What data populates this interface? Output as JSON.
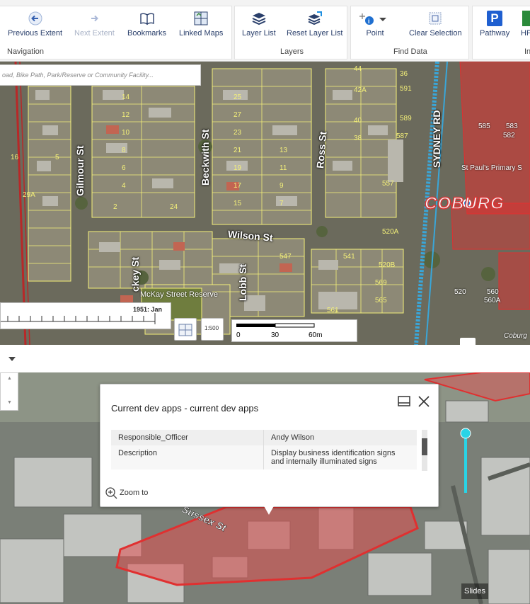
{
  "ribbon": {
    "navigation": {
      "group_label": "Navigation",
      "previous_extent": "Previous Extent",
      "next_extent": "Next Extent",
      "bookmarks": "Bookmarks",
      "linked_maps": "Linked Maps"
    },
    "layers": {
      "group_label": "Layers",
      "layer_list": "Layer List",
      "reset_layer_list": "Reset Layer List"
    },
    "find_data": {
      "group_label": "Find Data",
      "point": "Point",
      "clear_selection": "Clear Selection"
    },
    "pathway": {
      "label": "Pathway",
      "icon_letter": "P"
    },
    "cut_off": {
      "label": "HP",
      "group_label": "In"
    }
  },
  "map2d": {
    "search_placeholder": "oad, Bike Path, Park/Reserve or Community Facility...",
    "streets": [
      "Gilmour St",
      "Beckwith St",
      "Ross St",
      "Wilson St",
      "Lobb St",
      "ckey St",
      "SYDNEY RD"
    ],
    "reserve_label": "McKay Street Reserve",
    "school_label": "St Paul's Primary S",
    "suburb_label": "COBURG",
    "corner_label": "Coburg",
    "lot_numbers": [
      "14",
      "12",
      "10",
      "8",
      "6",
      "4",
      "2",
      "24",
      "29A",
      "16",
      "25",
      "27",
      "23",
      "21",
      "19",
      "17",
      "15",
      "13",
      "11",
      "9",
      "7",
      "5",
      "44",
      "42A",
      "40",
      "38",
      "36",
      "591",
      "589",
      "587",
      "585",
      "583",
      "582",
      "560",
      "560A",
      "520",
      "520A",
      "520B",
      "569",
      "565",
      "561",
      "557",
      "547",
      "541"
    ],
    "timeline_label": "1951: Jan",
    "scale": {
      "ratio_label": "1:500",
      "ticks": [
        "0",
        "30",
        "60m"
      ]
    }
  },
  "popup": {
    "title": "Current dev apps - current dev apps",
    "rows": [
      {
        "key": "Responsible_Officer",
        "value": "Andy Wilson"
      },
      {
        "key": "Description",
        "value": "Display business identification signs and internally illuminated signs"
      }
    ],
    "zoom_to": "Zoom to"
  },
  "map3d": {
    "road_label": "Sussex St",
    "slides_label": "Slides"
  },
  "colors": {
    "ribbon_text": "#2a3f6b",
    "highlight_red": "#e03030",
    "cadastre_yellow": "#f4f079",
    "rail_blue": "#3aa6d8",
    "cyan_marker": "#29d4e6"
  }
}
